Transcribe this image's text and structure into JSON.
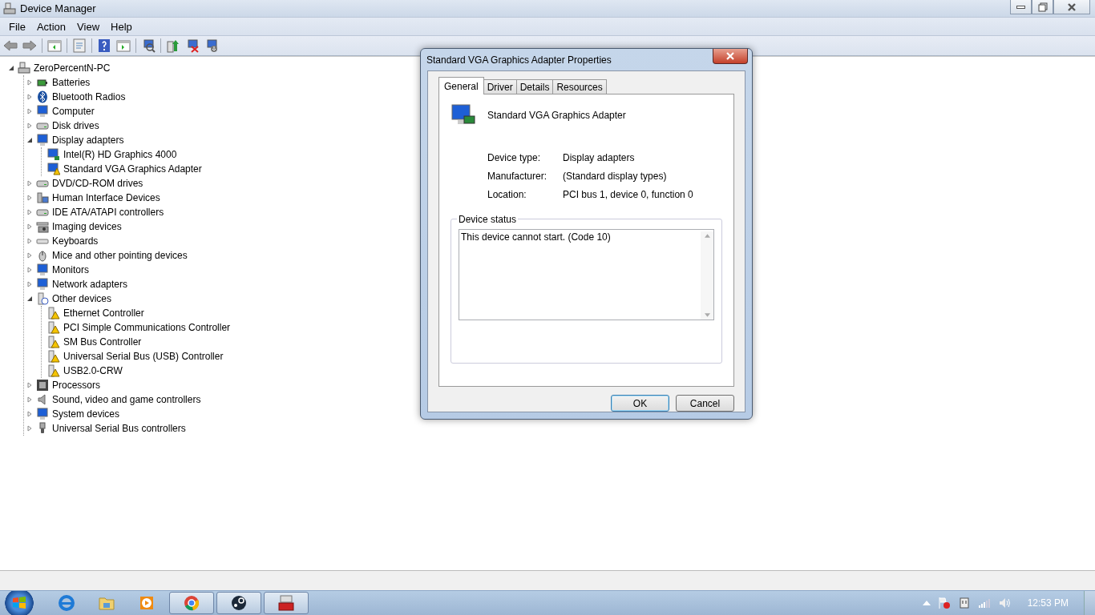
{
  "window": {
    "title": "Device Manager"
  },
  "menu": [
    "File",
    "Action",
    "View",
    "Help"
  ],
  "tree": {
    "label": "ZeroPercentN-PC",
    "kind": "pc",
    "expanded": true,
    "children": [
      {
        "label": "Batteries",
        "kind": "battery",
        "expanded": false
      },
      {
        "label": "Bluetooth Radios",
        "kind": "bluetooth",
        "expanded": false
      },
      {
        "label": "Computer",
        "kind": "monitor",
        "expanded": false
      },
      {
        "label": "Disk drives",
        "kind": "drive",
        "expanded": false
      },
      {
        "label": "Display adapters",
        "kind": "monitor",
        "expanded": true,
        "children": [
          {
            "label": "Intel(R) HD Graphics 4000",
            "kind": "monitor"
          },
          {
            "label": "Standard VGA Graphics Adapter",
            "kind": "monitor-warning"
          }
        ]
      },
      {
        "label": "DVD/CD-ROM drives",
        "kind": "drive",
        "expanded": false
      },
      {
        "label": "Human Interface Devices",
        "kind": "hid",
        "expanded": false
      },
      {
        "label": "IDE ATA/ATAPI controllers",
        "kind": "drive",
        "expanded": false
      },
      {
        "label": "Imaging devices",
        "kind": "camera",
        "expanded": false
      },
      {
        "label": "Keyboards",
        "kind": "keyboard",
        "expanded": false
      },
      {
        "label": "Mice and other pointing devices",
        "kind": "mouse",
        "expanded": false
      },
      {
        "label": "Monitors",
        "kind": "monitor",
        "expanded": false
      },
      {
        "label": "Network adapters",
        "kind": "monitor",
        "expanded": false
      },
      {
        "label": "Other devices",
        "kind": "unknown",
        "expanded": true,
        "children": [
          {
            "label": "Ethernet Controller",
            "kind": "warning"
          },
          {
            "label": "PCI Simple Communications Controller",
            "kind": "warning"
          },
          {
            "label": "SM Bus Controller",
            "kind": "warning"
          },
          {
            "label": "Universal Serial Bus (USB) Controller",
            "kind": "warning"
          },
          {
            "label": "USB2.0-CRW",
            "kind": "warning"
          }
        ]
      },
      {
        "label": "Processors",
        "kind": "chip",
        "expanded": false
      },
      {
        "label": "Sound, video and game controllers",
        "kind": "speaker",
        "expanded": false
      },
      {
        "label": "System devices",
        "kind": "monitor",
        "expanded": false
      },
      {
        "label": "Universal Serial Bus controllers",
        "kind": "usb",
        "expanded": false
      }
    ]
  },
  "dialog": {
    "title": "Standard VGA Graphics Adapter Properties",
    "tabs": [
      {
        "label": "General",
        "selected": true
      },
      {
        "label": "Driver",
        "selected": false
      },
      {
        "label": "Details",
        "selected": false
      },
      {
        "label": "Resources",
        "selected": false
      }
    ],
    "device_name": "Standard VGA Graphics Adapter",
    "properties": [
      {
        "label": "Device type:",
        "value": "Display adapters"
      },
      {
        "label": "Manufacturer:",
        "value": "(Standard display types)"
      },
      {
        "label": "Location:",
        "value": "PCI bus 1, device 0, function 0"
      }
    ],
    "status_group": "Device status",
    "status_text": "This device cannot start. (Code 10)",
    "buttons": [
      {
        "label": "OK",
        "default": true
      },
      {
        "label": "Cancel",
        "default": false
      }
    ]
  },
  "taskbar": {
    "items": [
      {
        "kind": "ie",
        "running": false
      },
      {
        "kind": "folder",
        "running": false
      },
      {
        "kind": "media",
        "running": false
      },
      {
        "kind": "chrome",
        "running": true
      },
      {
        "kind": "steam",
        "running": true
      },
      {
        "kind": "toolbox",
        "running": true
      }
    ],
    "clock": "12:53 PM"
  }
}
